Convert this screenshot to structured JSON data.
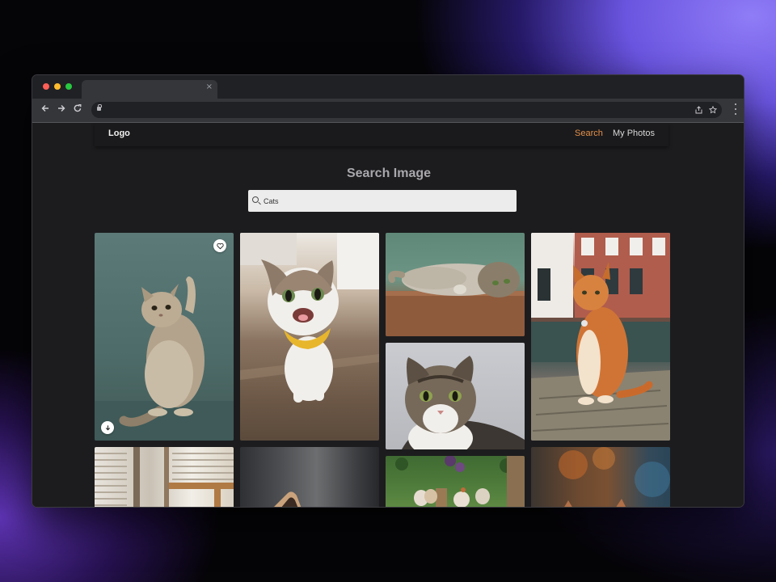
{
  "browser": {
    "tab_close": "×",
    "icons": [
      "back-arrow-icon",
      "forward-arrow-icon",
      "reload-icon",
      "lock-icon",
      "share-icon",
      "bookmark-star-icon",
      "kebab-menu-icon"
    ]
  },
  "navbar": {
    "logo": "Logo",
    "links": [
      {
        "label": "Search",
        "active": true,
        "color": "#e3904a"
      },
      {
        "label": "My Photos",
        "active": false,
        "color": "#d8d8d8"
      }
    ]
  },
  "page": {
    "heading": "Search Image",
    "search": {
      "value": "Cats",
      "icon": "search-icon"
    }
  },
  "gallery": {
    "items": [
      {
        "subject": "british shorthair cat reaching up, teal background",
        "actions": [
          "heart-icon",
          "download-icon"
        ]
      },
      {
        "subject": "happy tabby-white cat with yellow bandana on wooden floor",
        "actions": []
      },
      {
        "subject": "tabby cat lying upside down on wooden table, green wall",
        "actions": []
      },
      {
        "subject": "orange cat sitting on brick pavement by canal houses",
        "actions": []
      },
      {
        "subject": "tabby-white cat portrait, grey background",
        "actions": []
      },
      {
        "subject": "window with blinds, partially visible",
        "actions": []
      },
      {
        "subject": "cat ear silhouette, partially visible",
        "actions": []
      },
      {
        "subject": "kittens in garden with flowers, partially visible",
        "actions": []
      },
      {
        "subject": "cat with blurred bokeh background, partially visible",
        "actions": []
      }
    ]
  }
}
